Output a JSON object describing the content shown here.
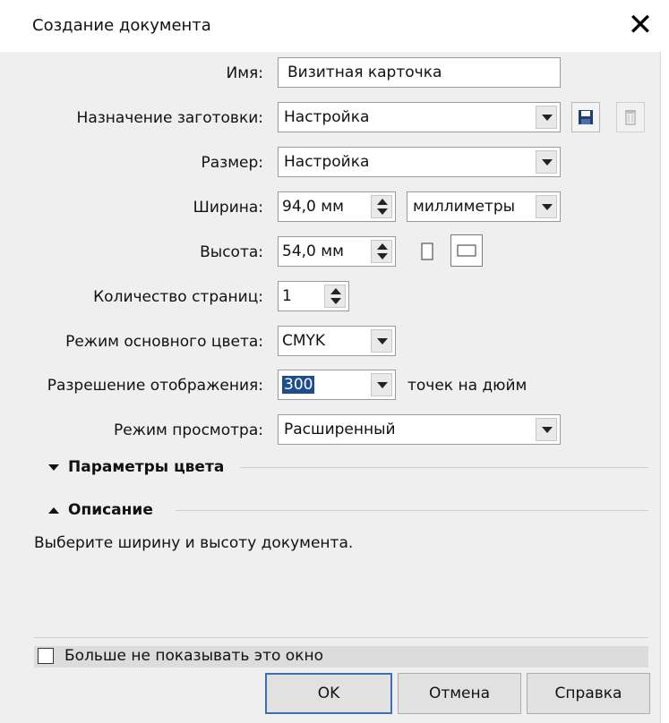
{
  "dialog": {
    "title": "Создание документа",
    "close_label": "✕"
  },
  "form": {
    "name_label": "Имя:",
    "name_value": "Визитная карточка",
    "preset_label": "Назначение заготовки:",
    "preset_value": "Настройка",
    "size_label": "Размер:",
    "size_value": "Настройка",
    "width_label": "Ширина:",
    "width_value": "94,0 мм",
    "units_value": "миллиметры",
    "height_label": "Высота:",
    "height_value": "54,0 мм",
    "pages_label": "Количество страниц:",
    "pages_value": "1",
    "color_mode_label": "Режим основного цвета:",
    "color_mode_value": "CMYK",
    "resolution_label": "Разрешение отображения:",
    "resolution_value": "300",
    "resolution_unit": "точек на дюйм",
    "preview_label": "Режим просмотра:",
    "preview_value": "Расширенный"
  },
  "sections": {
    "color_params": "Параметры цвета",
    "description": "Описание"
  },
  "description_text": "Выберите ширину и высоту документа.",
  "dont_show": {
    "label": "Больше не показывать это окно",
    "checked": false
  },
  "buttons": {
    "ok": "OK",
    "cancel": "Отмена",
    "help": "Справка"
  },
  "icons": {
    "save_preset": "floppy-disk-icon",
    "delete_preset": "trash-icon",
    "portrait": "portrait-page-icon",
    "landscape": "landscape-page-icon"
  },
  "colors": {
    "selection": "#1f4d8c",
    "default_button_border": "#3d6fb8",
    "save_icon": "#1b3f7a"
  }
}
